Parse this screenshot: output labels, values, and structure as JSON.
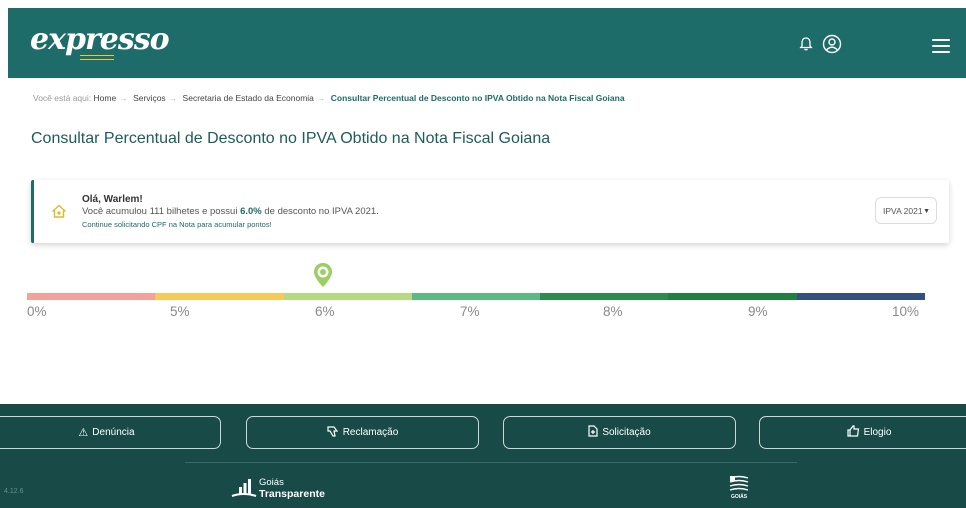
{
  "header": {
    "logo_text": "expresso",
    "bell_icon": "bell-icon",
    "user_icon": "user-circle-icon",
    "menu_icon": "hamburger-menu-icon",
    "background": "#1d6c6a"
  },
  "breadcrumb": {
    "prefix": "Você está aqui:",
    "items": [
      "Home",
      "Serviços",
      "Secretaria de Estado da Economia"
    ],
    "current": "Consultar Percentual de Desconto no IPVA Obtido na Nota Fiscal Goiana"
  },
  "page_title": "Consultar Percentual de Desconto no IPVA Obtido na Nota Fiscal Goiana",
  "card": {
    "icon": "home-icon",
    "greeting": "Olá, Warlem!",
    "message_prefix": "Você acumulou 111 bilhetes e possui",
    "discount": "6.0%",
    "message_suffix": "de desconto no IPVA 2021.",
    "hint": "Continue solicitando CPF na Nota para acumular pontos!",
    "select_value": "IPVA 2021"
  },
  "scale": {
    "current_percent": 6.0,
    "min": 0,
    "max": 10,
    "marker_icon": "location-marker-icon",
    "labels": [
      "0%",
      "5%",
      "6%",
      "7%",
      "8%",
      "9%",
      "10%"
    ],
    "segment_colors": [
      "#f3a19b",
      "#f6c95a",
      "#b5da82",
      "#5db883",
      "#2c8c4e",
      "#237e41",
      "#34507f"
    ]
  },
  "footer": {
    "buttons": [
      {
        "label": "Denúncia",
        "icon": "warning-icon"
      },
      {
        "label": "Reclamação",
        "icon": "thumbs-down-icon"
      },
      {
        "label": "Solicitação",
        "icon": "document-icon"
      },
      {
        "label": "Elogio",
        "icon": "thumbs-up-icon"
      }
    ],
    "version": "4.12.6",
    "goias_transparente_line1": "Goiás",
    "goias_transparente_line2": "Transparente",
    "goias_logo_text": "GOIÁS"
  }
}
